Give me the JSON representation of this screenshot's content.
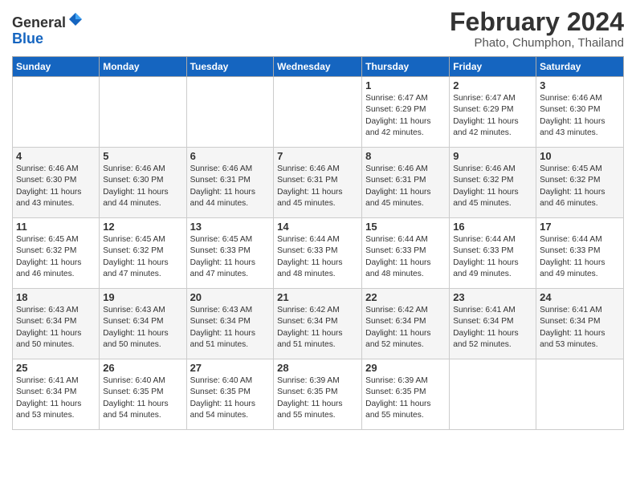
{
  "header": {
    "logo_general": "General",
    "logo_blue": "Blue",
    "month_year": "February 2024",
    "location": "Phato, Chumphon, Thailand"
  },
  "days_of_week": [
    "Sunday",
    "Monday",
    "Tuesday",
    "Wednesday",
    "Thursday",
    "Friday",
    "Saturday"
  ],
  "weeks": [
    [
      {
        "day": "",
        "info": ""
      },
      {
        "day": "",
        "info": ""
      },
      {
        "day": "",
        "info": ""
      },
      {
        "day": "",
        "info": ""
      },
      {
        "day": "1",
        "info": "Sunrise: 6:47 AM\nSunset: 6:29 PM\nDaylight: 11 hours and 42 minutes."
      },
      {
        "day": "2",
        "info": "Sunrise: 6:47 AM\nSunset: 6:29 PM\nDaylight: 11 hours and 42 minutes."
      },
      {
        "day": "3",
        "info": "Sunrise: 6:46 AM\nSunset: 6:30 PM\nDaylight: 11 hours and 43 minutes."
      }
    ],
    [
      {
        "day": "4",
        "info": "Sunrise: 6:46 AM\nSunset: 6:30 PM\nDaylight: 11 hours and 43 minutes."
      },
      {
        "day": "5",
        "info": "Sunrise: 6:46 AM\nSunset: 6:30 PM\nDaylight: 11 hours and 44 minutes."
      },
      {
        "day": "6",
        "info": "Sunrise: 6:46 AM\nSunset: 6:31 PM\nDaylight: 11 hours and 44 minutes."
      },
      {
        "day": "7",
        "info": "Sunrise: 6:46 AM\nSunset: 6:31 PM\nDaylight: 11 hours and 45 minutes."
      },
      {
        "day": "8",
        "info": "Sunrise: 6:46 AM\nSunset: 6:31 PM\nDaylight: 11 hours and 45 minutes."
      },
      {
        "day": "9",
        "info": "Sunrise: 6:46 AM\nSunset: 6:32 PM\nDaylight: 11 hours and 45 minutes."
      },
      {
        "day": "10",
        "info": "Sunrise: 6:45 AM\nSunset: 6:32 PM\nDaylight: 11 hours and 46 minutes."
      }
    ],
    [
      {
        "day": "11",
        "info": "Sunrise: 6:45 AM\nSunset: 6:32 PM\nDaylight: 11 hours and 46 minutes."
      },
      {
        "day": "12",
        "info": "Sunrise: 6:45 AM\nSunset: 6:32 PM\nDaylight: 11 hours and 47 minutes."
      },
      {
        "day": "13",
        "info": "Sunrise: 6:45 AM\nSunset: 6:33 PM\nDaylight: 11 hours and 47 minutes."
      },
      {
        "day": "14",
        "info": "Sunrise: 6:44 AM\nSunset: 6:33 PM\nDaylight: 11 hours and 48 minutes."
      },
      {
        "day": "15",
        "info": "Sunrise: 6:44 AM\nSunset: 6:33 PM\nDaylight: 11 hours and 48 minutes."
      },
      {
        "day": "16",
        "info": "Sunrise: 6:44 AM\nSunset: 6:33 PM\nDaylight: 11 hours and 49 minutes."
      },
      {
        "day": "17",
        "info": "Sunrise: 6:44 AM\nSunset: 6:33 PM\nDaylight: 11 hours and 49 minutes."
      }
    ],
    [
      {
        "day": "18",
        "info": "Sunrise: 6:43 AM\nSunset: 6:34 PM\nDaylight: 11 hours and 50 minutes."
      },
      {
        "day": "19",
        "info": "Sunrise: 6:43 AM\nSunset: 6:34 PM\nDaylight: 11 hours and 50 minutes."
      },
      {
        "day": "20",
        "info": "Sunrise: 6:43 AM\nSunset: 6:34 PM\nDaylight: 11 hours and 51 minutes."
      },
      {
        "day": "21",
        "info": "Sunrise: 6:42 AM\nSunset: 6:34 PM\nDaylight: 11 hours and 51 minutes."
      },
      {
        "day": "22",
        "info": "Sunrise: 6:42 AM\nSunset: 6:34 PM\nDaylight: 11 hours and 52 minutes."
      },
      {
        "day": "23",
        "info": "Sunrise: 6:41 AM\nSunset: 6:34 PM\nDaylight: 11 hours and 52 minutes."
      },
      {
        "day": "24",
        "info": "Sunrise: 6:41 AM\nSunset: 6:34 PM\nDaylight: 11 hours and 53 minutes."
      }
    ],
    [
      {
        "day": "25",
        "info": "Sunrise: 6:41 AM\nSunset: 6:34 PM\nDaylight: 11 hours and 53 minutes."
      },
      {
        "day": "26",
        "info": "Sunrise: 6:40 AM\nSunset: 6:35 PM\nDaylight: 11 hours and 54 minutes."
      },
      {
        "day": "27",
        "info": "Sunrise: 6:40 AM\nSunset: 6:35 PM\nDaylight: 11 hours and 54 minutes."
      },
      {
        "day": "28",
        "info": "Sunrise: 6:39 AM\nSunset: 6:35 PM\nDaylight: 11 hours and 55 minutes."
      },
      {
        "day": "29",
        "info": "Sunrise: 6:39 AM\nSunset: 6:35 PM\nDaylight: 11 hours and 55 minutes."
      },
      {
        "day": "",
        "info": ""
      },
      {
        "day": "",
        "info": ""
      }
    ]
  ]
}
